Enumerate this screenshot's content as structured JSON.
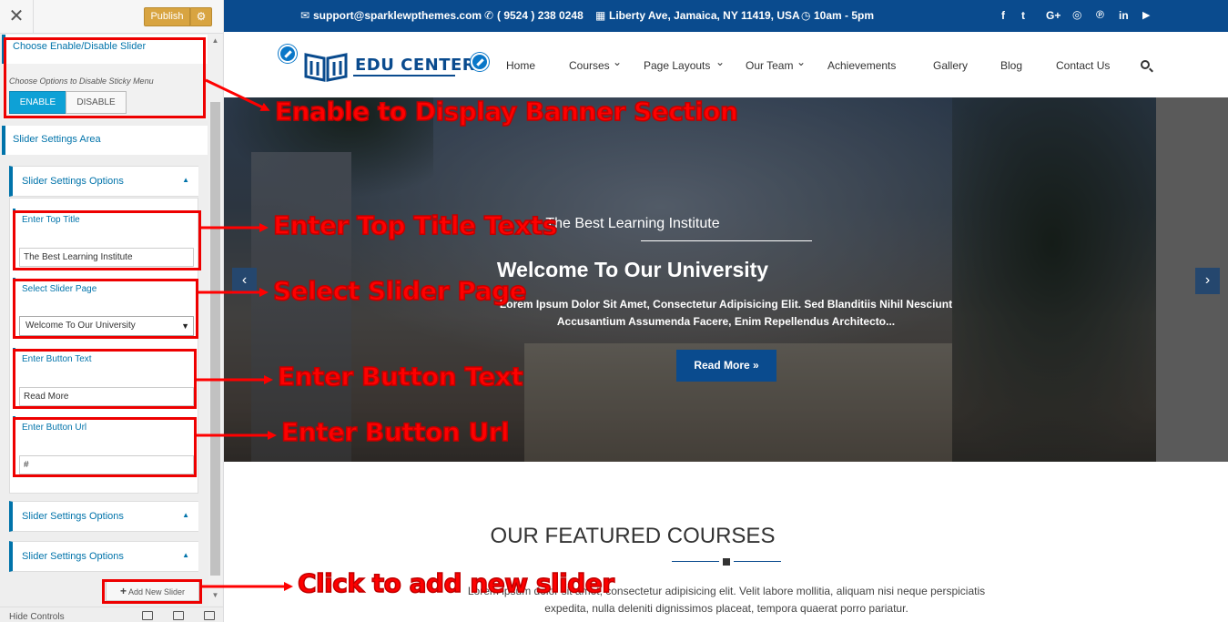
{
  "sidebar": {
    "close_glyph": "✕",
    "publish_label": "Publish",
    "gear_glyph": "⚙",
    "enable_section_title": "Choose Enable/Disable Slider",
    "enable_desc": "Choose Options to Disable Sticky Menu",
    "enable_label": "ENABLE",
    "disable_label": "DISABLE",
    "slider_area_title": "Slider Settings Area",
    "accordion_title": "Slider Settings Options",
    "accordion_title_2": "Slider Settings Options",
    "accordion_title_3": "Slider Settings Options",
    "caret_glyph": "▲",
    "top_title_label": "Enter Top Title",
    "top_title_value": "The Best Learning Institute",
    "slider_page_label": "Select Slider Page",
    "slider_page_value": "Welcome To Our University",
    "dropdown_glyph": "▼",
    "button_text_label": "Enter Button Text",
    "button_text_value": "Read More",
    "button_url_label": "Enter Button Url",
    "button_url_value": "#",
    "add_new_icon": "+",
    "add_new_label": "Add New Slider",
    "hide_controls": "Hide Controls"
  },
  "annotations": {
    "banner": "Enable to Display Banner Section",
    "top_title": "Enter Top Title Texts",
    "slider_page": "Select Slider Page",
    "button_text": "Enter Button Text",
    "button_url": "Enter Button Url",
    "add_slider": "Click to add new slider",
    "color": "#ff0000"
  },
  "topbar": {
    "email": "support@sparklewpthemes.com",
    "phone": "( 9524 ) 238 0248",
    "address": "Liberty Ave, Jamaica, NY 11419, USA",
    "hours": "10am - 5pm",
    "email_icon": "✉",
    "phone_icon": "✆",
    "address_icon": "▦",
    "hours_icon": "◷",
    "social": [
      "f",
      "t",
      "G+",
      "◎",
      "℗",
      "in",
      "▶"
    ]
  },
  "nav": {
    "logo_text": "EDU CENTER",
    "items": [
      "Home",
      "Courses",
      "Page Layouts",
      "Our Team",
      "Achievements",
      "Gallery",
      "Blog",
      "Contact Us"
    ],
    "chevron": "⌄"
  },
  "banner": {
    "top_title": "The Best Learning Institute",
    "title": "Welcome To Our University",
    "desc_line1": "Lorem Ipsum Dolor Sit Amet, Consectetur Adipisicing Elit. Sed Blanditiis Nihil Nesciunt",
    "desc_line2": "Accusantium Assumenda Facere, Enim Repellendus Architecto...",
    "button": "Read More »",
    "prev": "‹",
    "next": "›"
  },
  "featured": {
    "title": "OUR FEATURED COURSES",
    "desc_line1": "Lorem ipsum dolor sit amet, consectetur adipisicing elit. Velit labore mollitia, aliquam nisi neque perspiciatis",
    "desc_line2": "expedita, nulla deleniti dignissimos placeat, tempora quaerat porro pariatur."
  },
  "colors": {
    "primary": "#0a4b8e",
    "customizer_accent": "#0073aa",
    "publish": "#d8a441",
    "annotation": "#ff0000"
  }
}
